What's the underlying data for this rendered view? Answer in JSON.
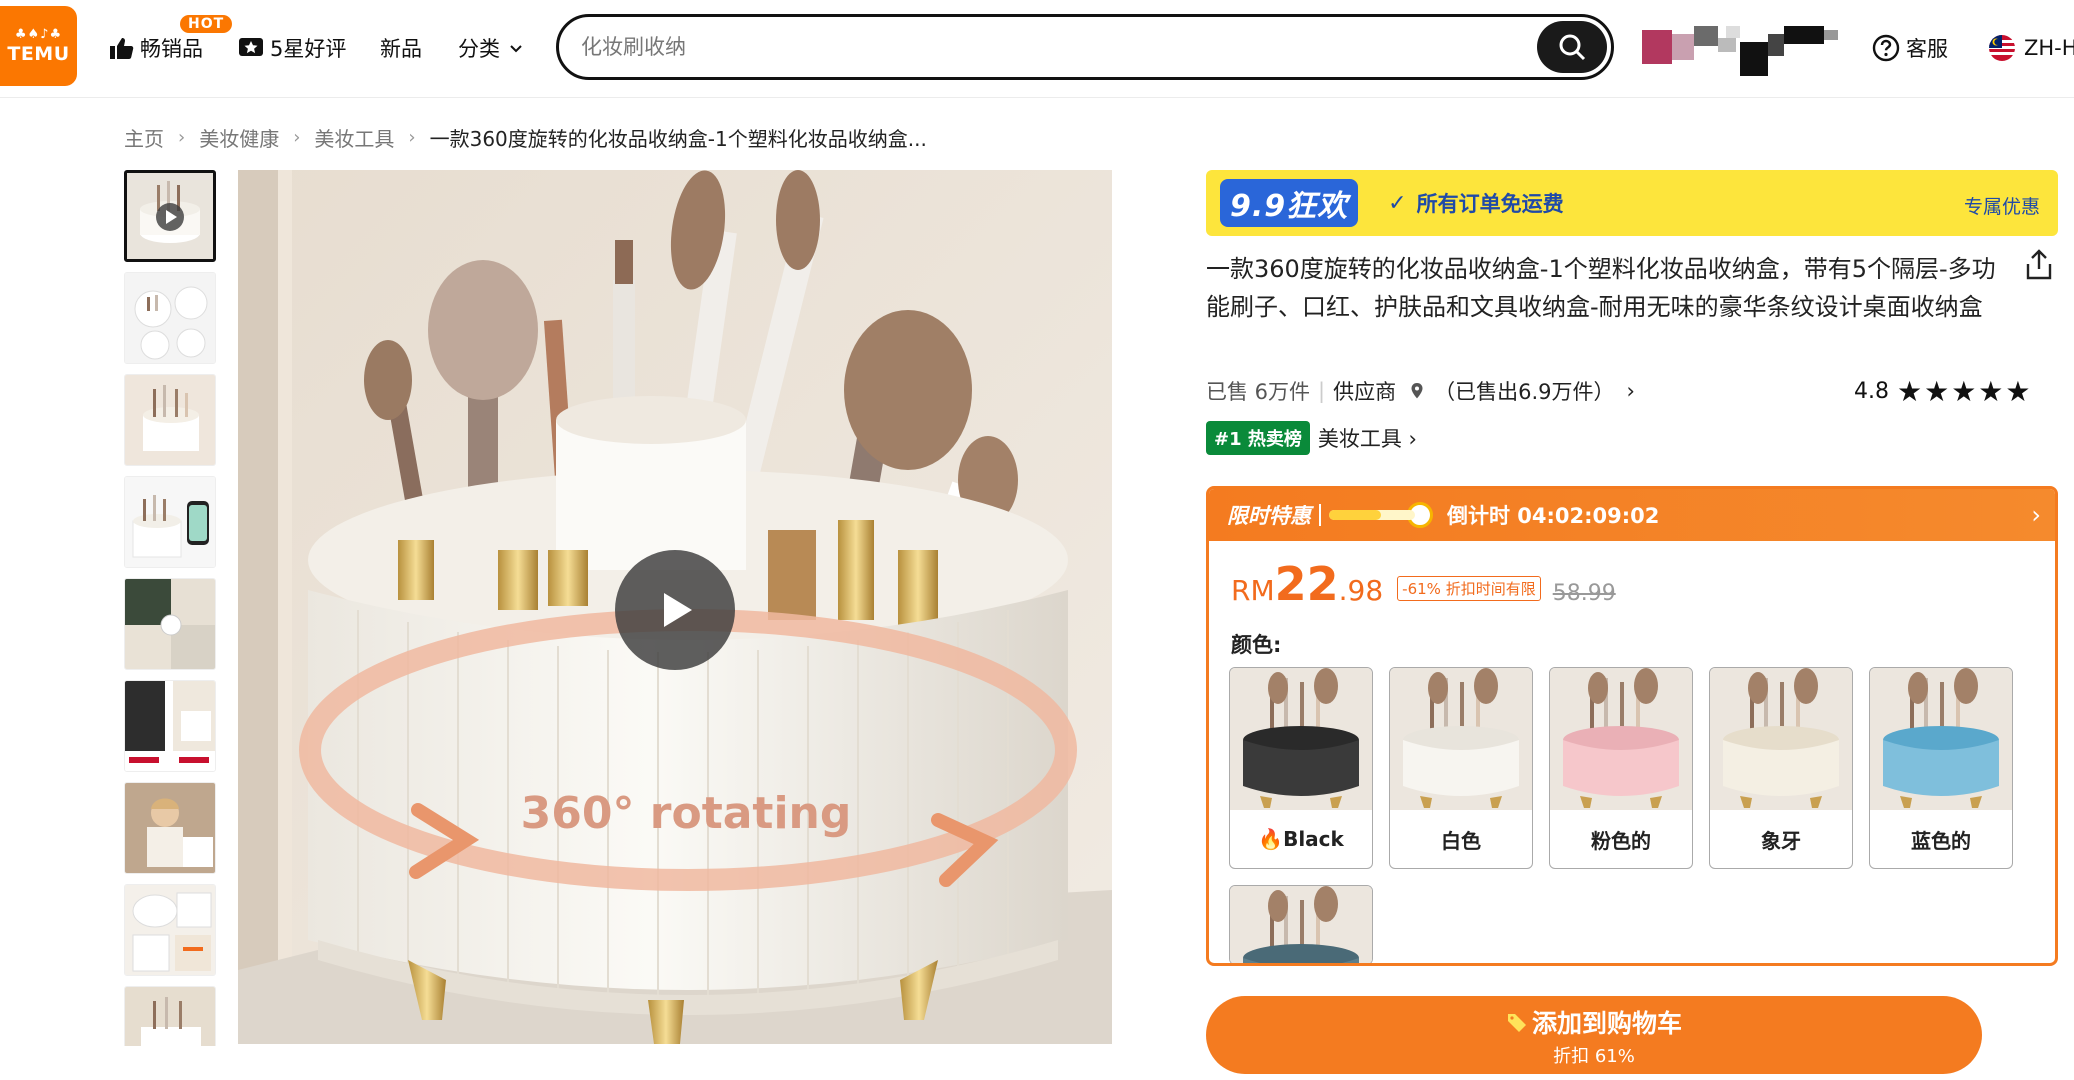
{
  "header": {
    "logo_text": "TEMU",
    "logo_glyphs": "♣♠♪♣",
    "nav": [
      {
        "label": "畅销品",
        "icon": "thumbs-up-icon"
      },
      {
        "label": "5星好评",
        "icon": "star-badge-icon"
      },
      {
        "label": "新品"
      },
      {
        "label": "分类",
        "icon": "chevron-down-icon"
      }
    ],
    "hot_badge": "HOT",
    "search_placeholder": "化妆刷收纳",
    "customer_service": "客服",
    "language": "ZH-H"
  },
  "breadcrumb": [
    "主页",
    "美妆健康",
    "美妆工具",
    "一款360度旋转的化妆品收纳盒-1个塑料化妆品收纳盒..."
  ],
  "promo": {
    "tag": "9.9狂欢",
    "check": "✓",
    "text": "所有订单免运费",
    "link": "专属优惠"
  },
  "product": {
    "title": "一款360度旋转的化妆品收纳盒-1个塑料化妆品收纳盒，带有5个隔层-多功能刷子、口红、护肤品和文具收纳盒-耐用无味的豪华条纹设计桌面收纳盒",
    "sold": "已售 6万件",
    "divider": "|",
    "supplier": "供应商",
    "supplier_sold": "（已售出6.9万件）",
    "rating": "4.8",
    "stars": "★★★★★",
    "rank_badge": "#1 热卖榜",
    "rank_category": "美妆工具 ›",
    "image_caption": "360° rotating"
  },
  "deal": {
    "label": "限时特惠",
    "progress": 0.6,
    "countdown": "倒计时 04:02:09:02",
    "price_currency": "RM",
    "price_int": "22",
    "price_dec": ".98",
    "discount_badge": "-61% 折扣时间有限",
    "original_price": "58.99",
    "color_label": "颜色:"
  },
  "colors": [
    {
      "label": "🔥Black",
      "body": "#3a3a3a",
      "rim": "#2a2a2a"
    },
    {
      "label": "白色",
      "body": "#f7f5f0",
      "rim": "#e8e4dc"
    },
    {
      "label": "粉色的",
      "body": "#f6c7cb",
      "rim": "#eab0b6"
    },
    {
      "label": "象牙",
      "body": "#f4efe3",
      "rim": "#e6ddcb"
    },
    {
      "label": "蓝色的",
      "body": "#7fbfdc",
      "rim": "#5aa8cc"
    },
    {
      "label": "",
      "body": "#5d7f8c",
      "rim": "#4a6a77"
    }
  ],
  "cart": {
    "label": "添加到购物车",
    "sub": "折扣 61%"
  },
  "thumbnail_count": 9
}
